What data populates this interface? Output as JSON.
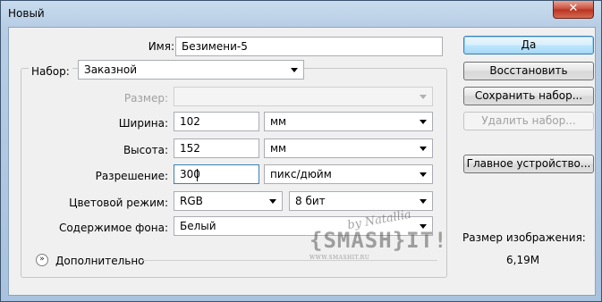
{
  "window": {
    "title": "Новый",
    "close_glyph": "✕"
  },
  "form": {
    "name_label": "Имя:",
    "name_value": "Безимени-5",
    "preset_label": "Набор:",
    "preset_value": "Заказной",
    "size_label": "Размер:",
    "size_value": "",
    "width_label": "Ширина:",
    "width_value": "102",
    "width_unit": "мм",
    "height_label": "Высота:",
    "height_value": "152",
    "height_unit": "мм",
    "resolution_label": "Разрешение:",
    "resolution_value": "300",
    "resolution_unit": "пикс/дюйм",
    "colormode_label": "Цветовой режим:",
    "colormode_value": "RGB",
    "bitdepth_value": "8 бит",
    "background_label": "Содержимое фона:",
    "background_value": "Белый",
    "advanced_label": "Дополнительно"
  },
  "buttons": {
    "ok": "Да",
    "reset": "Восстановить",
    "save_preset": "Сохранить набор...",
    "delete_preset": "Удалить набор...",
    "device_central": "Главное устройство..."
  },
  "info": {
    "image_size_label": "Размер изображения:",
    "image_size_value": "6,19M"
  },
  "watermark": {
    "line1": "by Natallia",
    "line2": "{SMASH}IT!",
    "line3": "WWW.SMASHIT.RU"
  },
  "colors": {
    "default_button_border": "#3c7fb1",
    "close_button": "#c74a38",
    "frame": "#b7cde4"
  }
}
